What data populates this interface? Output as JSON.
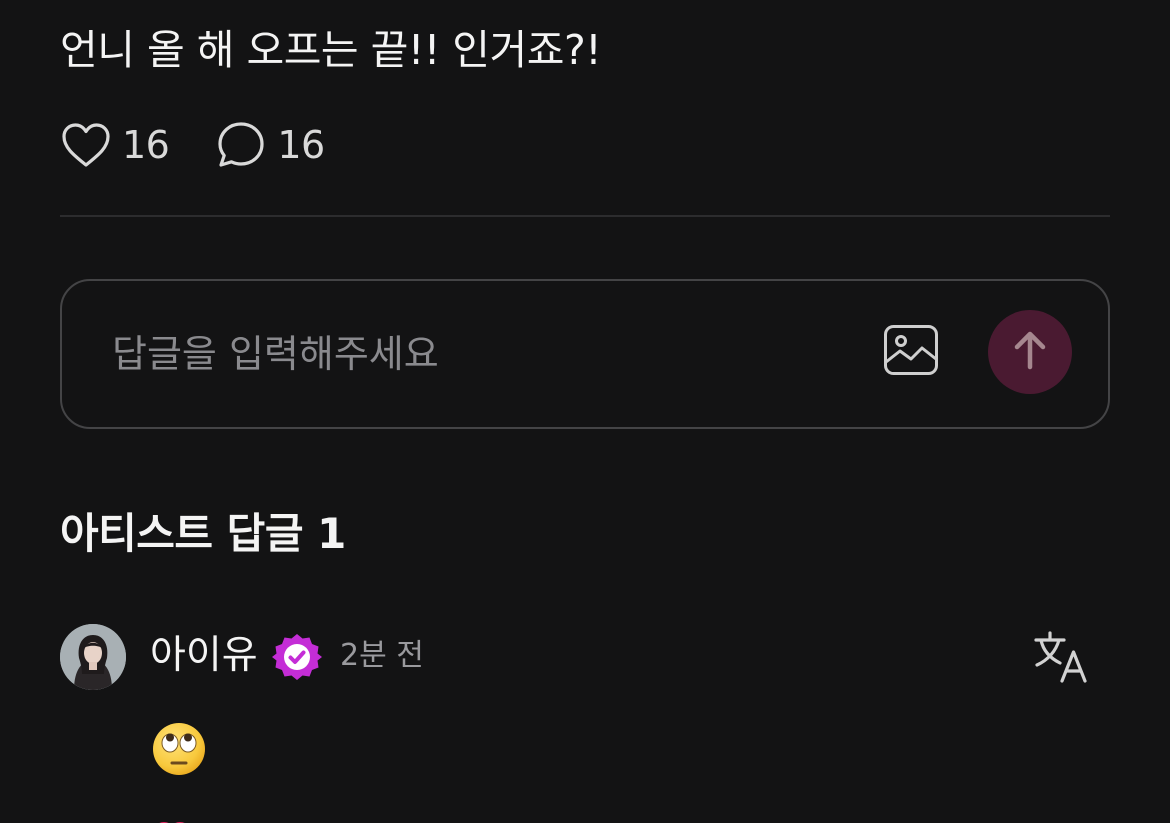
{
  "post": {
    "text": "언니 올 해 오프는 끝!! 인거죠?!",
    "likes": "16",
    "comments": "16"
  },
  "reply": {
    "placeholder": "답글을 입력해주세요"
  },
  "artist_replies": {
    "title": "아티스트 답글 1"
  },
  "comment": {
    "author": "아이유",
    "time": "2분 전",
    "body_emoji": "face-with-rolling-eyes-emoji"
  },
  "icons": {
    "like": "heart-icon",
    "comment": "speech-bubble-icon",
    "image": "image-icon",
    "send": "arrow-up-icon",
    "verified": "verified-badge-icon",
    "translate": "translate-icon"
  },
  "colors": {
    "background": "#131314",
    "send_button": "#4a1a31",
    "verified_badge": "#c42dd6",
    "muted_text": "#9a9a9e"
  }
}
